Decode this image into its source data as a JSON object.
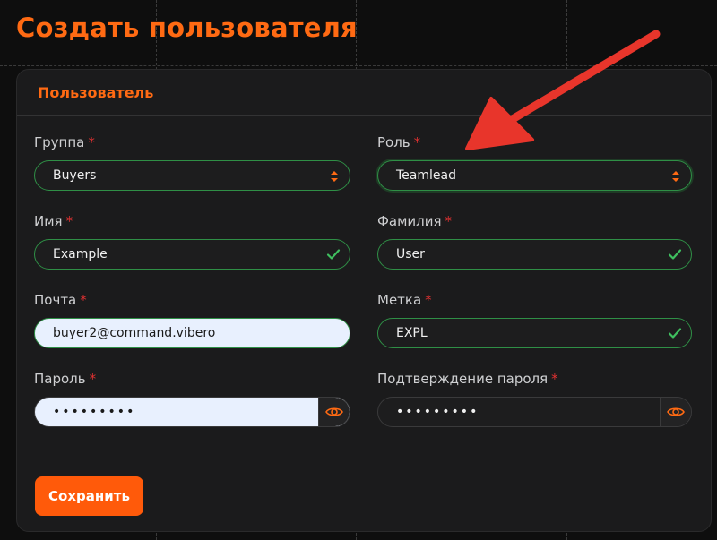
{
  "page": {
    "title": "Создать пользователя"
  },
  "card": {
    "title": "Пользователь"
  },
  "form": {
    "required_mark": "*",
    "group": {
      "label": "Группа",
      "value": "Buyers"
    },
    "role": {
      "label": "Роль",
      "value": "Teamlead"
    },
    "first_name": {
      "label": "Имя",
      "value": "Example"
    },
    "last_name": {
      "label": "Фамилия",
      "value": "User"
    },
    "email": {
      "label": "Почта",
      "value": "buyer2@command.vibero"
    },
    "tag": {
      "label": "Метка",
      "value": "EXPL"
    },
    "password": {
      "label": "Пароль",
      "value": "•••••••••"
    },
    "password_confirm": {
      "label": "Подтверждение пароля",
      "value": "•••••••••"
    },
    "save_label": "Сохранить"
  },
  "colors": {
    "accent": "#ff6a13",
    "valid_border": "#2f8f46",
    "required": "#e03131",
    "annotation_arrow": "#e8352b"
  },
  "icons": [
    "select-arrows-icon",
    "check-icon",
    "eye-icon",
    "annotation-arrow"
  ]
}
